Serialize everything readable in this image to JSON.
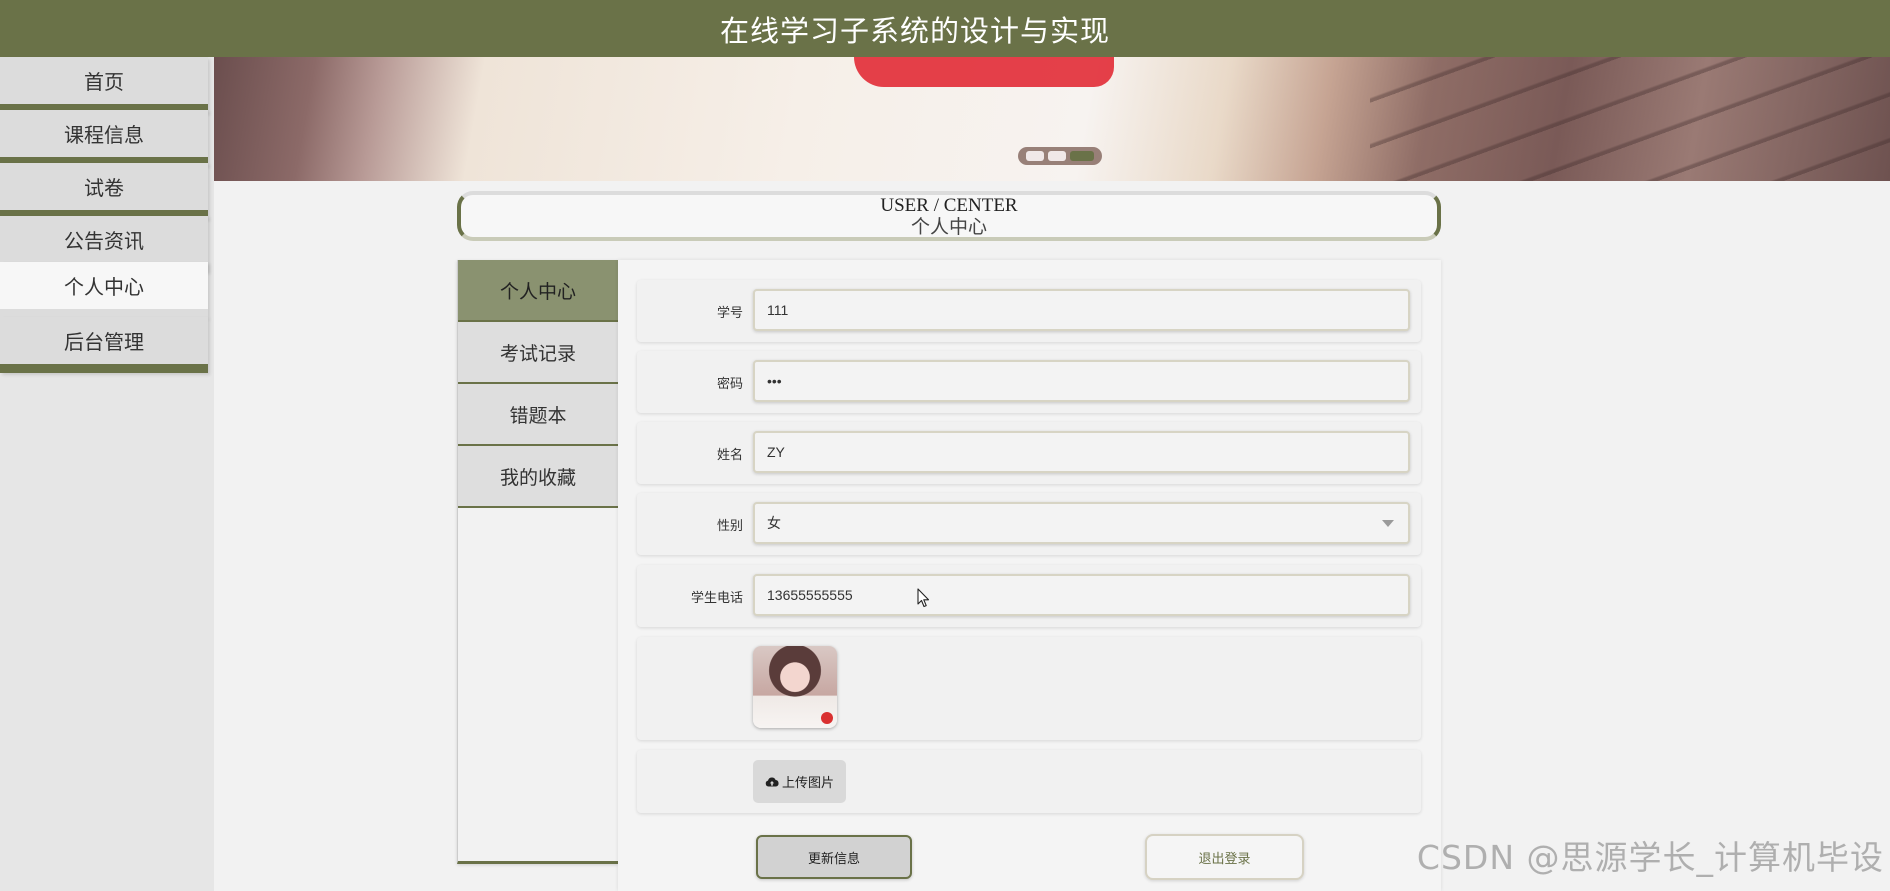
{
  "header": {
    "title": "在线学习子系统的设计与实现"
  },
  "sidebar": {
    "items": [
      {
        "label": "首页"
      },
      {
        "label": "课程信息"
      },
      {
        "label": "试卷"
      },
      {
        "label": "公告资讯"
      },
      {
        "label": "个人中心",
        "active": true
      },
      {
        "label": "后台管理"
      }
    ]
  },
  "banner": {
    "carousel_count": 3,
    "active_index": 2
  },
  "section": {
    "title_en": "USER / CENTER",
    "title_cn": "个人中心"
  },
  "subnav": {
    "items": [
      {
        "label": "个人中心",
        "active": true
      },
      {
        "label": "考试记录"
      },
      {
        "label": "错题本"
      },
      {
        "label": "我的收藏"
      }
    ]
  },
  "form": {
    "student_id": {
      "label": "学号",
      "value": "111"
    },
    "password": {
      "label": "密码",
      "value": "•••"
    },
    "name": {
      "label": "姓名",
      "value": "ZY"
    },
    "gender": {
      "label": "性别",
      "value": "女"
    },
    "phone": {
      "label": "学生电话",
      "value": "13655555555"
    },
    "upload_label": "上传图片"
  },
  "actions": {
    "update_label": "更新信息",
    "logout_label": "退出登录"
  },
  "watermark": "CSDN @思源学长_计算机毕设",
  "colors": {
    "accent": "#6a7248",
    "accent_light": "#8a9270",
    "background": "#f2f2f2"
  }
}
